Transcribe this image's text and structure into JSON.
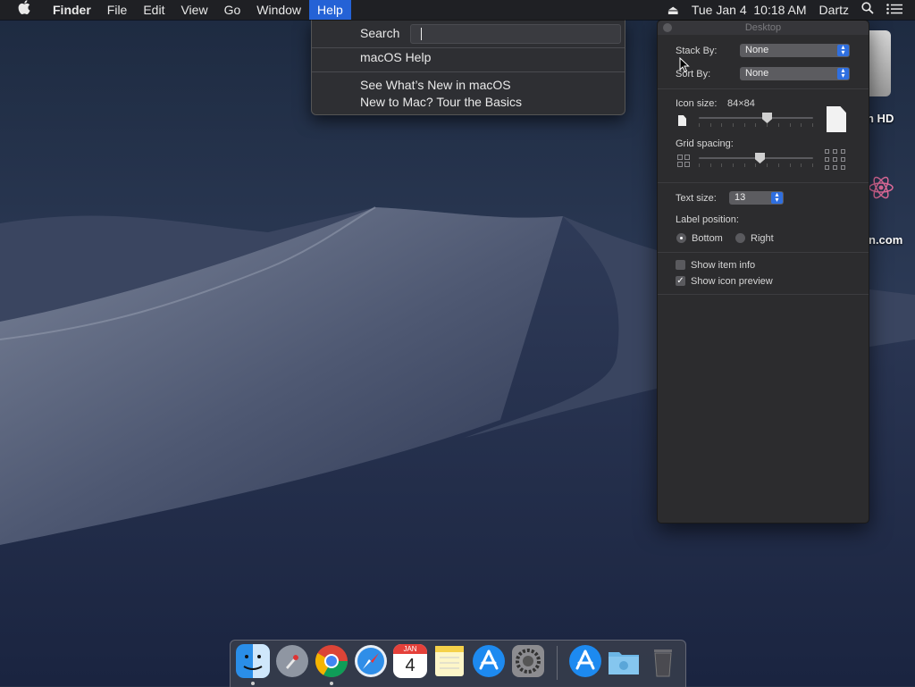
{
  "menubar": {
    "apple_icon": "apple-logo",
    "app_name": "Finder",
    "menus": [
      "File",
      "Edit",
      "View",
      "Go",
      "Window",
      "Help"
    ],
    "active_menu": "Help",
    "status": {
      "eject_icon": "eject-icon",
      "date_time": "Tue Jan 4  10:18 AM",
      "user": "Dartz",
      "search_icon": "spotlight-search-icon",
      "list_icon": "notification-center-icon"
    }
  },
  "help_menu": {
    "search_label": "Search",
    "search_value": "",
    "items": [
      "macOS Help",
      "See What’s New in macOS",
      "New to Mac? Tour the Basics"
    ]
  },
  "inspector": {
    "title": "Desktop",
    "stack_by_label": "Stack By:",
    "stack_by_value": "None",
    "sort_by_label": "Sort By:",
    "sort_by_value": "None",
    "icon_size_label": "Icon size:",
    "icon_size_value": "84×84",
    "icon_size_level": 0.6,
    "grid_spacing_label": "Grid spacing:",
    "grid_spacing_level": 0.5,
    "text_size_label": "Text size:",
    "text_size_value": "13",
    "label_position_label": "Label position:",
    "label_position_options": [
      "Bottom",
      "Right"
    ],
    "label_position_selected": "Bottom",
    "show_item_info_label": "Show item info",
    "show_item_info_checked": false,
    "show_icon_preview_label": "Show icon preview",
    "show_icon_preview_checked": true
  },
  "desktop_icons": {
    "disk_label": "h HD",
    "app_label": "n.com"
  },
  "dock": {
    "apps": [
      {
        "name": "Finder",
        "icon": "finder-icon",
        "running": true
      },
      {
        "name": "Launchpad",
        "icon": "launchpad-icon",
        "running": false
      },
      {
        "name": "Google Chrome",
        "icon": "chrome-icon",
        "running": true
      },
      {
        "name": "Safari",
        "icon": "safari-icon",
        "running": false
      },
      {
        "name": "Calendar",
        "icon": "calendar-icon",
        "running": false,
        "month": "JAN",
        "day": "4"
      },
      {
        "name": "Notes",
        "icon": "notes-icon",
        "running": false
      },
      {
        "name": "App Store",
        "icon": "app-store-icon",
        "running": false
      },
      {
        "name": "System Preferences",
        "icon": "system-preferences-icon",
        "running": false
      },
      {
        "name": "Applications",
        "icon": "applications-folder-icon",
        "running": false
      },
      {
        "name": "Downloads",
        "icon": "downloads-folder-icon",
        "running": false
      },
      {
        "name": "Trash",
        "icon": "trash-icon",
        "running": false
      }
    ]
  },
  "colors": {
    "menu_highlight": "#2462d6",
    "popup_accent": "#2f6fe0",
    "menubar_bg": "#1f2024",
    "panel_bg": "#2c2c2e"
  }
}
